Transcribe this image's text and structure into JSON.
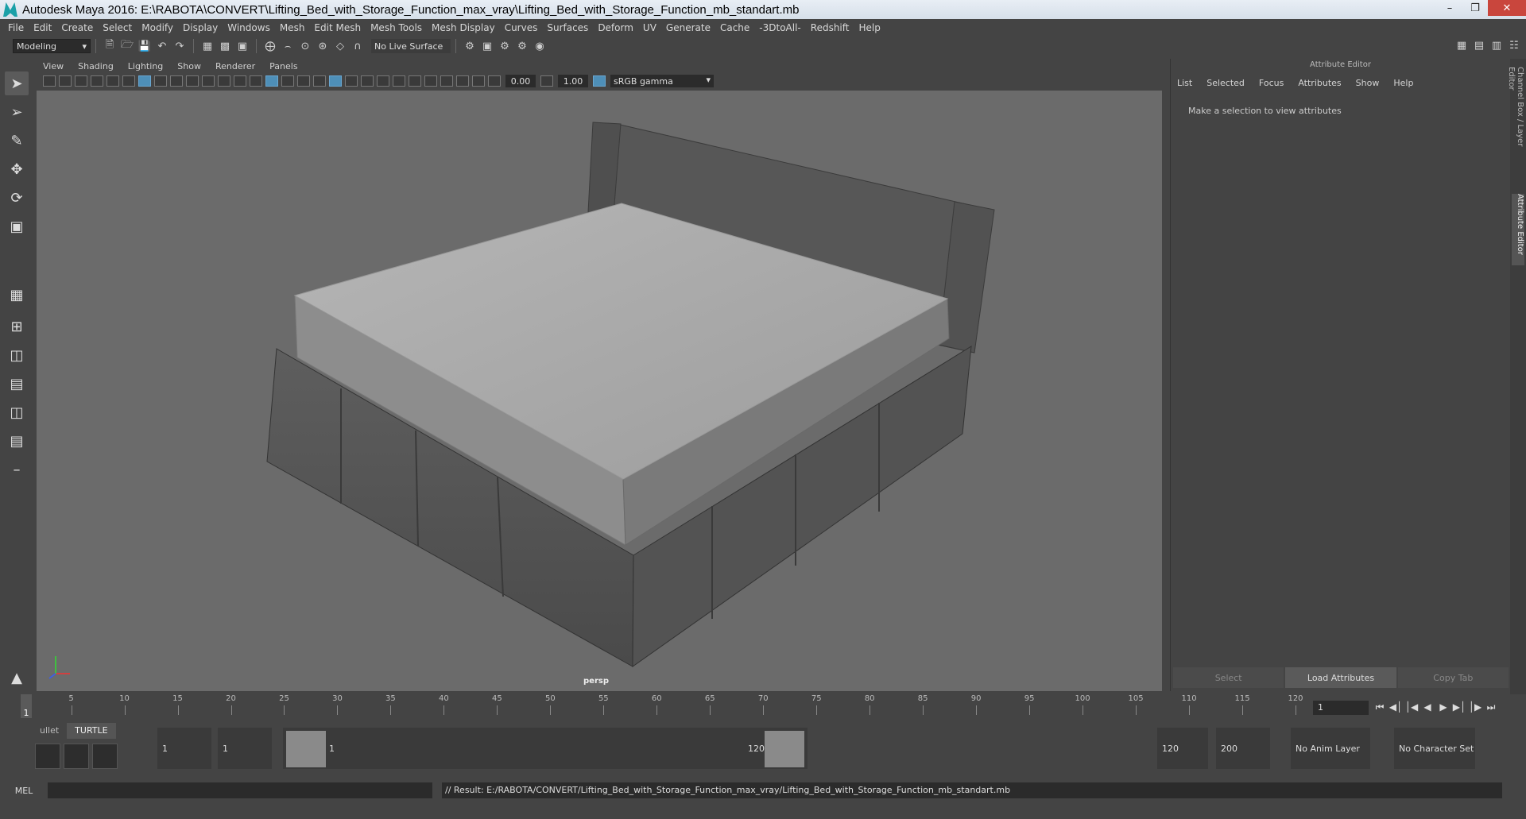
{
  "window": {
    "title": "Autodesk Maya 2016: E:\\RABOTA\\CONVERT\\Lifting_Bed_with_Storage_Function_max_vray\\Lifting_Bed_with_Storage_Function_mb_standart.mb"
  },
  "menubar": [
    "File",
    "Edit",
    "Create",
    "Select",
    "Modify",
    "Display",
    "Windows",
    "Mesh",
    "Edit Mesh",
    "Mesh Tools",
    "Mesh Display",
    "Curves",
    "Surfaces",
    "Deform",
    "UV",
    "Generate",
    "Cache",
    "-3DtoAll-",
    "Redshift",
    "Help"
  ],
  "statusline": {
    "mode": "Modeling",
    "live_surface": "No Live Surface"
  },
  "viewport": {
    "menu": [
      "View",
      "Shading",
      "Lighting",
      "Show",
      "Renderer",
      "Panels"
    ],
    "exposure": "0.00",
    "gamma": "1.00",
    "color_space": "sRGB gamma",
    "camera": "persp"
  },
  "attribute_editor": {
    "title": "Attribute Editor",
    "menu": [
      "List",
      "Selected",
      "Focus",
      "Attributes",
      "Show",
      "Help"
    ],
    "message": "Make a selection to view attributes",
    "buttons": {
      "select": "Select",
      "load": "Load Attributes",
      "copy": "Copy Tab"
    },
    "side_tabs": [
      "Channel Box / Layer Editor",
      "Attribute Editor"
    ]
  },
  "timeslider": {
    "ticks": [
      "5",
      "10",
      "15",
      "20",
      "25",
      "30",
      "35",
      "40",
      "45",
      "50",
      "55",
      "60",
      "65",
      "70",
      "75",
      "80",
      "85",
      "90",
      "95",
      "100",
      "105",
      "110",
      "115",
      "120"
    ],
    "current_frame": "1",
    "frame_field": "1"
  },
  "range": {
    "shelf_tabs": [
      "ullet",
      "TURTLE"
    ],
    "start_a": "1",
    "start_b": "1",
    "slider_start": "1",
    "slider_end": "120",
    "end_a": "120",
    "end_b": "200",
    "anim_layer": "No Anim Layer",
    "character_set": "No Character Set"
  },
  "cmdline": {
    "label": "MEL",
    "result": "// Result: E:/RABOTA/CONVERT/Lifting_Bed_with_Storage_Function_max_vray/Lifting_Bed_with_Storage_Function_mb_standart.mb"
  },
  "colors": {
    "viewport_bg": "#6b6b6b",
    "panel": "#444444",
    "accent": "#4e8fb8"
  }
}
